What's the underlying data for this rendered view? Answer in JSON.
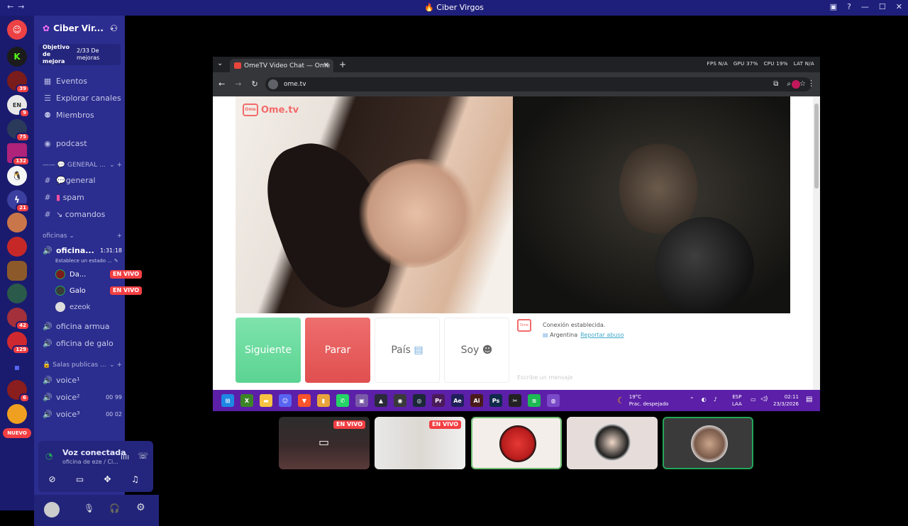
{
  "window": {
    "title": "Ciber Virgos"
  },
  "server": {
    "name": "Ciber Vir...",
    "boost_label": "Objetivo de mejora",
    "boost_progress": "2/33 De mejoras"
  },
  "rail": {
    "badges": [
      "39",
      "9",
      "75",
      "132",
      "21",
      "129",
      "42",
      "129",
      "6"
    ],
    "new_label": "NUEVO"
  },
  "nav": {
    "events": "Eventos",
    "browse": "Explorar canales",
    "members": "Miembros",
    "podcast": "podcast"
  },
  "categories": {
    "general": "GENERAL ...",
    "oficinas": "oficinas",
    "salas": "Salas publicas ..."
  },
  "channels": {
    "general": "general",
    "spam": "spam",
    "comandos": "comandos",
    "oficina_active": "oficina...",
    "oficina_timer": "1:31:18",
    "oficina_status": "Establece un estado ...",
    "oficina_armua": "oficina armua",
    "oficina_galo": "oficina de galo",
    "voice1": "voice¹",
    "voice2": "voice²",
    "voice3": "voice³",
    "voice2_count": "00",
    "voice2_limit": "99",
    "voice3_count": "00",
    "voice3_limit": "02"
  },
  "voice_users": [
    {
      "name": "Da...",
      "live": "EN VIVO"
    },
    {
      "name": "Galo",
      "live": "EN VIVO"
    },
    {
      "name": "ezeok",
      "live": ""
    }
  ],
  "voice_panel": {
    "status": "Voz conectada",
    "channel": "oficina de eze / Ci..."
  },
  "browser": {
    "tab_title": "OmeTV Video Chat — Ome",
    "url": "ome.tv",
    "overlay": [
      "FPS N/A",
      "GPU 37%",
      "CPU 19%",
      "LAT N/A"
    ]
  },
  "ometv": {
    "logo": "Ome.tv",
    "btn_next": "Siguiente",
    "btn_stop": "Parar",
    "btn_country": "País",
    "btn_gender": "Soy",
    "chat_status": "Conexión establecida.",
    "chat_country": "Argentina",
    "chat_report": "Reportar abuso",
    "chat_placeholder": "Escribe un mensaje"
  },
  "taskbar": {
    "temp": "19°C",
    "weather": "Prac. despejado",
    "lang1": "ESP",
    "lang2": "LAA",
    "time": "02:11",
    "date": "23/3/2026"
  },
  "stream_tiles": [
    {
      "live": "EN VIVO"
    },
    {
      "live": "EN VIVO"
    }
  ],
  "colors": {
    "discord_bg": "#2b2d8f",
    "rail_bg": "#1a1b6e",
    "live_red": "#f23f43",
    "next_green": "#5bd492",
    "stop_red": "#e04f4f",
    "taskbar_purple": "#5c1fa8"
  }
}
